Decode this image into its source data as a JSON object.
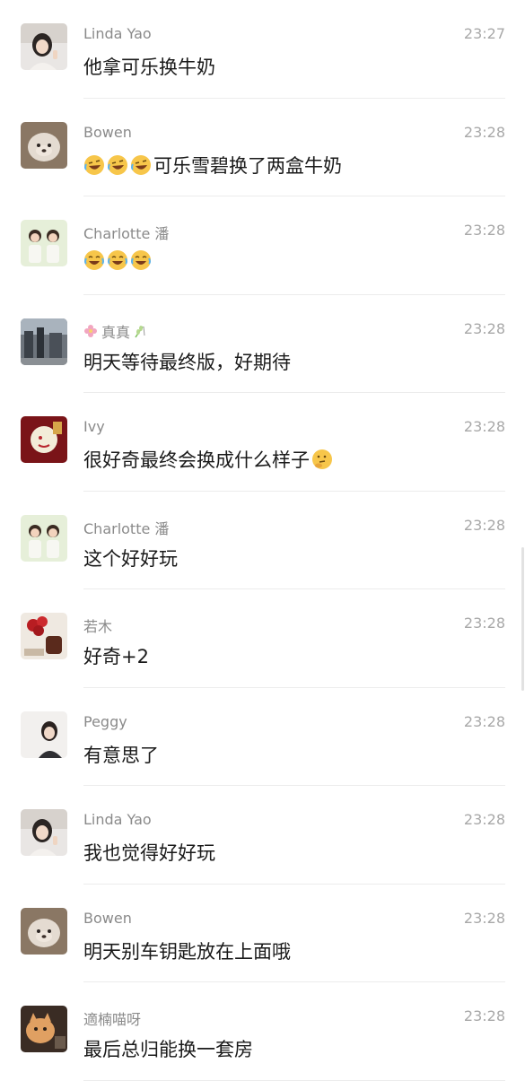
{
  "messages": [
    {
      "name": "Linda Yao",
      "time": "23:27",
      "text": "他拿可乐换牛奶",
      "avatar": "girl-photo-avatar",
      "emoji": 0
    },
    {
      "name": "Bowen",
      "time": "23:28",
      "text": "可乐雪碧换了两盒牛奶",
      "avatar": "dog-photo-avatar",
      "emoji": 3,
      "emoji_type": "laugh-cry-tilted"
    },
    {
      "name": "Charlotte 潘",
      "time": "23:28",
      "text": "",
      "avatar": "kids-photo-avatar",
      "emoji": 3,
      "emoji_type": "laugh-cry"
    },
    {
      "name": "真真",
      "time": "23:28",
      "text": "明天等待最终版，好期待",
      "avatar": "street-photo-avatar",
      "emoji": 0,
      "name_prefix_icon": "flower-icon",
      "name_suffix_icon": "wheat-icon"
    },
    {
      "name": "Ivy",
      "time": "23:28",
      "text": "很好奇最终会换成什么样子",
      "avatar": "red-card-avatar",
      "emoji_after": "thinking-face"
    },
    {
      "name": "Charlotte 潘",
      "time": "23:28",
      "text": "这个好好玩",
      "avatar": "kids-photo-avatar",
      "emoji": 0
    },
    {
      "name": "若木",
      "time": "23:28",
      "text": "好奇+2",
      "avatar": "roses-photo-avatar",
      "emoji": 0
    },
    {
      "name": "Peggy",
      "time": "23:28",
      "text": "有意思了",
      "avatar": "woman-photo-avatar",
      "emoji": 0
    },
    {
      "name": "Linda Yao",
      "time": "23:28",
      "text": "我也觉得好好玩",
      "avatar": "girl-photo-avatar",
      "emoji": 0
    },
    {
      "name": "Bowen",
      "time": "23:28",
      "text": "明天别车钥匙放在上面哦",
      "avatar": "dog-photo-avatar",
      "emoji": 0
    },
    {
      "name": "適楠喵呀",
      "time": "23:28",
      "text": "最后总归能换一套房",
      "avatar": "cat-photo-avatar",
      "emoji": 0
    }
  ],
  "colors": {
    "name": "#8a8a8a",
    "time": "#a8a8a8",
    "message": "#1a1a1a",
    "divider": "#ececec"
  }
}
